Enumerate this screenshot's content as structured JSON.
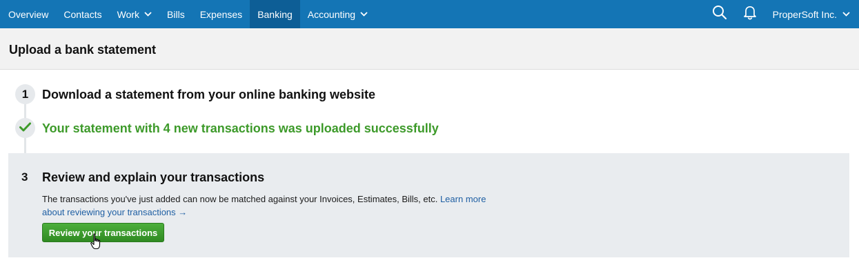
{
  "nav": {
    "items": [
      {
        "label": "Overview",
        "has_menu": false,
        "active": false
      },
      {
        "label": "Contacts",
        "has_menu": false,
        "active": false
      },
      {
        "label": "Work",
        "has_menu": true,
        "active": false
      },
      {
        "label": "Bills",
        "has_menu": false,
        "active": false
      },
      {
        "label": "Expenses",
        "has_menu": false,
        "active": false
      },
      {
        "label": "Banking",
        "has_menu": false,
        "active": true
      },
      {
        "label": "Accounting",
        "has_menu": true,
        "active": false
      }
    ],
    "search_icon": "search-icon",
    "bell_icon": "bell-icon",
    "org_name": "ProperSoft Inc.",
    "bar_color": "#1475b5",
    "active_color": "#0d5e96"
  },
  "page": {
    "title": "Upload a bank statement"
  },
  "steps": {
    "step1": {
      "number": "1",
      "title": "Download a statement from your online banking website"
    },
    "step2": {
      "status_icon": "check-icon",
      "title": "Your statement with 4 new transactions was uploaded successfully",
      "color": "#3d9a2a"
    },
    "step3": {
      "number": "3",
      "title": "Review and explain your transactions",
      "description": "The transactions you've just added can now be matched against your Invoices, Estimates, Bills, etc. ",
      "link_text": "Learn more about reviewing your transactions →",
      "button_label": "Review your transactions"
    }
  }
}
